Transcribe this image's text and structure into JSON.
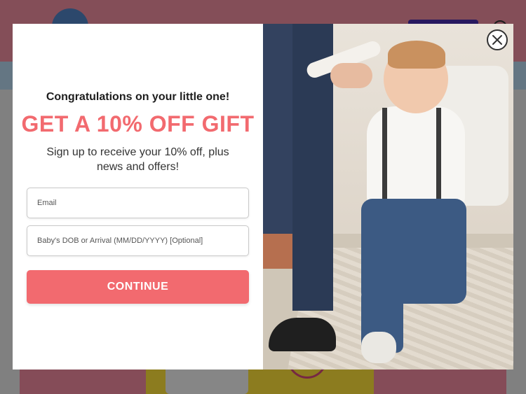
{
  "modal": {
    "congrats": "Congratulations on your little one!",
    "headline": "GET A 10% OFF GIFT",
    "subtext_line1": "Sign up to receive your 10% off, plus",
    "subtext_line2": "news and offers!",
    "email_placeholder": "Email",
    "dob_placeholder": "Baby's DOB or Arrival (MM/DD/YYYY) [Optional]",
    "continue_label": "CONTINUE",
    "close_icon": "close-icon"
  },
  "colors": {
    "accent": "#f26a6f",
    "header_bg": "#f08ea0"
  }
}
